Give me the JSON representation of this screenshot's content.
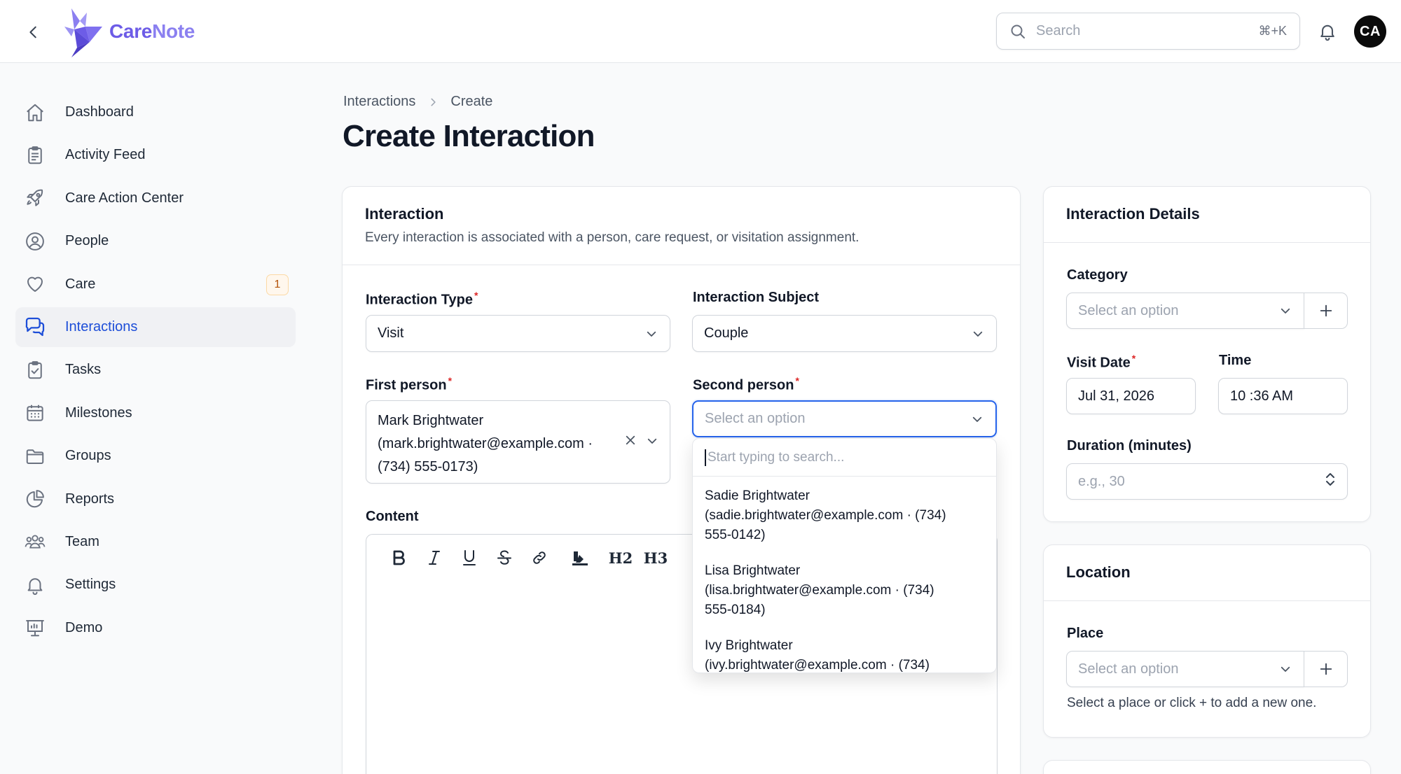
{
  "app": {
    "name_part1": "Care",
    "name_part2": "Note",
    "search_placeholder": "Search",
    "search_shortcut": "⌘+K",
    "user_initials": "CA",
    "brand_color": "#6d5ce7",
    "active_color": "#1d4ed8"
  },
  "sidebar": {
    "items": [
      {
        "label": "Dashboard",
        "icon": "home-icon"
      },
      {
        "label": "Activity Feed",
        "icon": "clipboard-icon"
      },
      {
        "label": "Care Action Center",
        "icon": "rocket-icon"
      },
      {
        "label": "People",
        "icon": "user-circle-icon"
      },
      {
        "label": "Care",
        "icon": "heart-icon",
        "badge": "1"
      },
      {
        "label": "Interactions",
        "icon": "chat-bubbles-icon",
        "active": true
      },
      {
        "label": "Tasks",
        "icon": "clipboard-check-icon"
      },
      {
        "label": "Milestones",
        "icon": "calendar-icon"
      },
      {
        "label": "Groups",
        "icon": "folder-icon"
      },
      {
        "label": "Reports",
        "icon": "pie-chart-icon"
      },
      {
        "label": "Team",
        "icon": "users-icon"
      },
      {
        "label": "Settings",
        "icon": "bell-icon"
      },
      {
        "label": "Demo",
        "icon": "presentation-icon"
      }
    ]
  },
  "breadcrumb": {
    "parent": "Interactions",
    "current": "Create"
  },
  "page": {
    "title": "Create Interaction"
  },
  "interaction_card": {
    "title": "Interaction",
    "description": "Every interaction is associated with a person, care request, or visitation assignment.",
    "type_label": "Interaction Type",
    "type_value": "Visit",
    "subject_label": "Interaction Subject",
    "subject_value": "Couple",
    "first_person_label": "First person",
    "first_person_line1": "Mark Brightwater",
    "first_person_line2": "(mark.brightwater@example.com ·",
    "first_person_line3": "(734) 555-0173)",
    "second_person_label": "Second person",
    "second_person_placeholder": "Select an option",
    "content_label": "Content",
    "toolbar": [
      "B",
      "I",
      "U",
      "S",
      "link",
      "highlight",
      "H2",
      "H3"
    ]
  },
  "dropdown": {
    "search_placeholder": "Start typing to search...",
    "options": [
      {
        "line1": "Sadie Brightwater",
        "line2": "(sadie.brightwater@example.com · (734)",
        "line3": "555-0142)"
      },
      {
        "line1": "Lisa Brightwater",
        "line2": "(lisa.brightwater@example.com · (734)",
        "line3": "555-0184)"
      },
      {
        "line1": "Ivy Brightwater",
        "line2": "(ivy.brightwater@example.com · (734)",
        "line3": ""
      }
    ]
  },
  "details_card": {
    "title": "Interaction Details",
    "category_label": "Category",
    "category_placeholder": "Select an option",
    "visit_date_label": "Visit Date",
    "visit_date_value": "Jul 31, 2026",
    "time_label": "Time",
    "time_value": "10 :36 AM",
    "duration_label": "Duration (minutes)",
    "duration_placeholder": "e.g., 30"
  },
  "location_card": {
    "title": "Location",
    "place_label": "Place",
    "place_placeholder": "Select an option",
    "place_hint": "Select a place or click + to add a new one."
  }
}
